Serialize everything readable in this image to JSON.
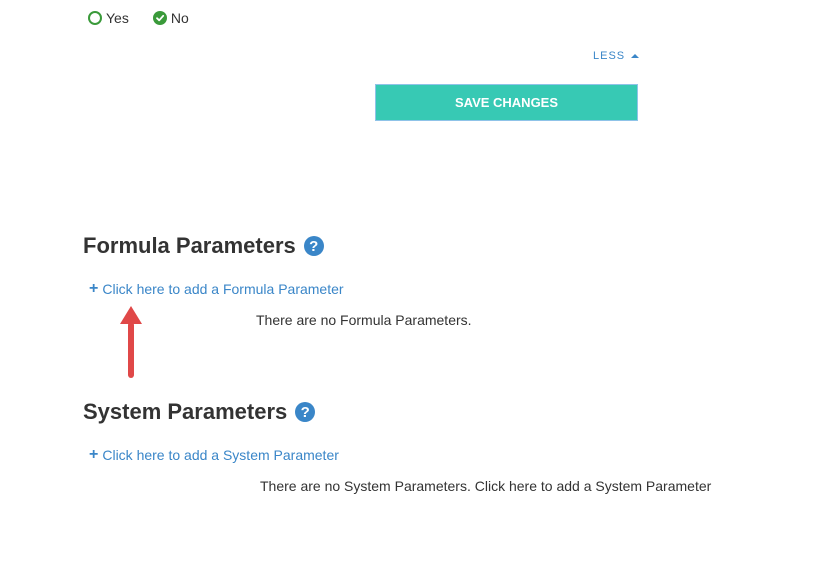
{
  "radio_group": {
    "options": [
      {
        "label": "Yes",
        "checked": false
      },
      {
        "label": "No",
        "checked": true
      }
    ],
    "accent_color": "#3a9a3a"
  },
  "toggle": {
    "label": "LESS",
    "icon": "caret-up-icon"
  },
  "save_button": {
    "label": "SAVE CHANGES",
    "color": "#37c9b4"
  },
  "formula_section": {
    "title": "Formula Parameters",
    "help_icon": "help-icon",
    "add_link_label": "Click here to add a Formula Parameter",
    "empty_message": "There are no Formula Parameters."
  },
  "system_section": {
    "title": "System Parameters",
    "help_icon": "help-icon",
    "add_link_label": "Click here to add a System Parameter",
    "empty_message": "There are no System Parameters. Click here to add a System Parameter"
  },
  "annotation": {
    "icon": "red-arrow-icon",
    "color": "#e04848"
  },
  "colors": {
    "link": "#3a86c8",
    "text": "#333333"
  }
}
